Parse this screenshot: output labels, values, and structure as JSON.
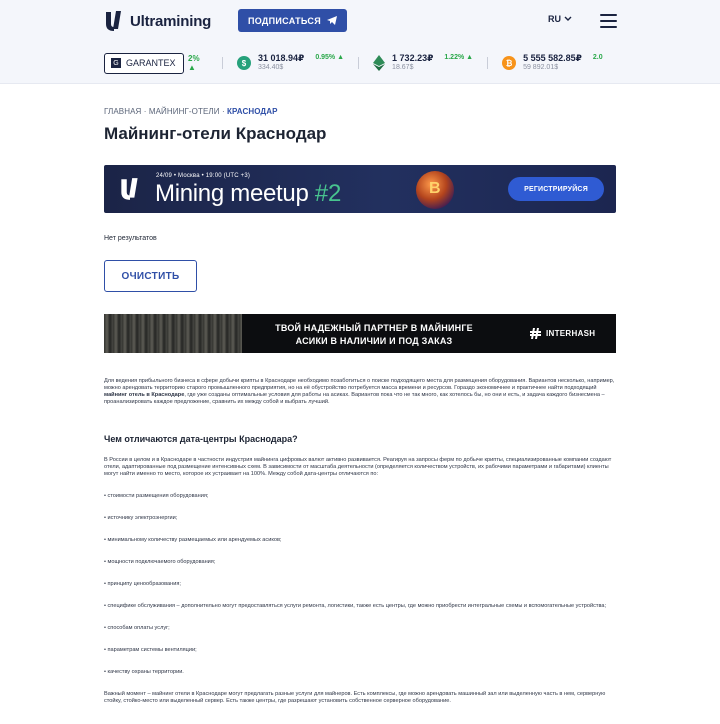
{
  "header": {
    "brand": "Ultramining",
    "subscribe_label": "ПОДПИСАТЬСЯ",
    "language": "RU"
  },
  "ticker": {
    "exchange": "GARANTEX",
    "cut_change": "2%",
    "items": [
      {
        "icon": "dollar-coin-icon",
        "color": "#26a17b",
        "price": "31 018.94₽",
        "usd": "334.40$",
        "change": "0.95%"
      },
      {
        "icon": "ethereum-icon",
        "color": "#2e8b57",
        "price": "1 732.23₽",
        "usd": "18.67$",
        "change": "1.22%"
      },
      {
        "icon": "bitcoin-icon",
        "color": "#f7931a",
        "price": "5 555 582.85₽",
        "usd": "59 892.01$",
        "change": "2.0"
      }
    ]
  },
  "breadcrumb": {
    "home": "ГЛАВНАЯ",
    "sep": "·",
    "section": "МАЙНИНГ-ОТЕЛИ",
    "current": "КРАСНОДАР"
  },
  "page_title": "Майнинг-отели Краснодар",
  "promo": {
    "meta": "24/09   •   Москва   •   19:00 (UTC +3)",
    "title": "Mining meetup ",
    "title_num": "#2",
    "button": "РЕГИСТРИРУЙСЯ"
  },
  "search": {
    "no_results": "Нет результатов",
    "clear_label": "ОЧИСТИТЬ"
  },
  "ad": {
    "line1": "ТВОЙ НАДЕЖНЫЙ ПАРТНЕР В МАЙНИНГЕ",
    "line2": "АСИКИ В НАЛИЧИИ И ПОД ЗАКАЗ",
    "brand": "INTERHASH"
  },
  "article": {
    "intro_before": "Для ведения прибыльного бизнеса в сфере добычи крипты в Краснодаре необходимо позаботиться о поиске подходящего места для размещения оборудования. Вариантов несколько, например, можно арендовать территорию старого промышленного предприятия, но на её обустройство потребуется масса времени и ресурсов. Гораздо экономичнее и практичнее найти подходящий ",
    "intro_bold": "майнинг отель в Краснодаре",
    "intro_after": ", где уже созданы оптимальные условия для работы на асиках. Вариантов пока что не так много, как хотелось бы, но они и есть, и задача каждого бизнесмена – проанализировать каждое предложение, сравнить их между собой и выбрать лучший.",
    "h2": "Чем отличаются дата-центры Краснодара?",
    "p2": "В России в целом и в Краснодаре в частности индустрия майнинга цифровых валют активно развивается. Реагируя на запросы ферм по добыче крипты, специализированные компании создают отели, адаптированные под размещение интенсивных схем. В зависимости от масштаба деятельности (определяется количеством устройств, их рабочими параметрами и габаритами) клиенты могут найти именно то место, которое их устраивает на 100%. Между собой дата-центры отличаются по:",
    "list": [
      "• стоимости размещения оборудования;",
      "• источнику электроэнергии;",
      "• минимальному количеству размещаемых или арендуемых асиков;",
      "• мощности подключаемого оборудования;",
      "• принципу ценообразования;",
      "• специфике обслуживания – дополнительно могут предоставляться услуги ремонта, логистики, также есть центры, где можно приобрести интегральные схемы и вспомогательные устройства;",
      "• способам оплаты услуг;",
      "• параметрам системы вентиляции;",
      "• качеству охраны территории."
    ],
    "closing": "Важный момент – майнинг отели в Краснодаре могут предлагать разные услуги для майнеров. Есть комплексы, где можно арендовать машинный зал или выделенную часть в нем, серверную стойку, стойко-место или выделенный сервер. Есть также центры, где разрешают установить собственное серверное оборудование."
  }
}
